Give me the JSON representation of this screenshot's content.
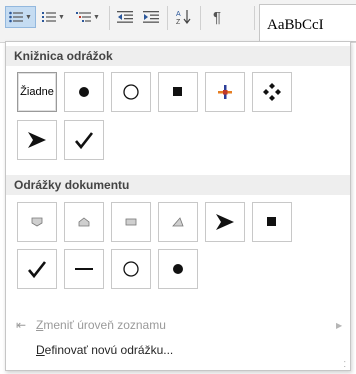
{
  "ribbon": {
    "styles_preview": "AaBbCcI"
  },
  "bullet_library": {
    "header": "Knižnica odrážok",
    "none_label": "Žiadne"
  },
  "document_bullets": {
    "header": "Odrážky dokumentu"
  },
  "menu": {
    "change_level": {
      "accel": "Z",
      "rest": "meniť úroveň zoznamu"
    },
    "define_new": {
      "accel": "D",
      "rest": "efinovať novú odrážku..."
    }
  }
}
